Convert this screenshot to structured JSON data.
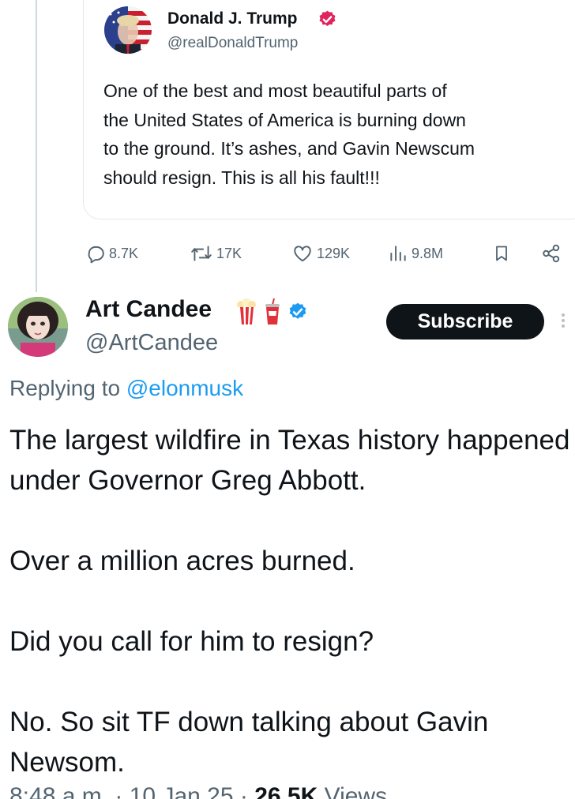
{
  "quoted_tweet": {
    "author_name": "Donald J. Trump",
    "author_handle": "@realDonaldTrump",
    "text": "One of the best and most beautiful parts of\nthe United States of America is burning down\nto the ground. It’s ashes, and Gavin Newscum\nshould resign. This is all his fault!!!",
    "badge_color": "#e0245e"
  },
  "actions": {
    "replies": "8.7K",
    "reposts": "17K",
    "likes": "129K",
    "views": "9.8M"
  },
  "reply": {
    "author_name": "Art Candee",
    "author_handle": "@ArtCandee",
    "emojis": [
      "popcorn-icon",
      "soda-cup-icon"
    ],
    "badge_color": "#1d9bf0",
    "subscribe_label": "Subscribe",
    "replying_prefix": "Replying to ",
    "replying_to": "@elonmusk",
    "paragraphs": [
      "The largest wildfire in Texas history happened under Governor Greg Abbott.",
      "Over a million acres burned.",
      "Did you call for him to resign?",
      "No.  So sit TF down talking about Gavin Newsom."
    ],
    "time": "8:48 a.m.",
    "date": "10 Jan 25",
    "views_count": "26.5K",
    "views_label": "Views"
  }
}
